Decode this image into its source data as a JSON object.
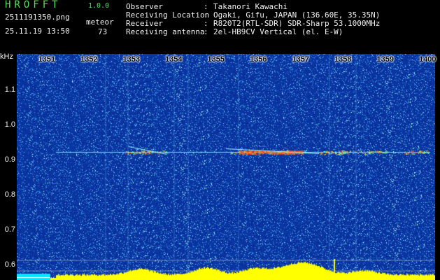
{
  "app": {
    "title": "HROFFT",
    "version": "1.0.0"
  },
  "file": {
    "name": "2511191350.png",
    "timestamp": "25.11.19 13:50"
  },
  "meteor": {
    "label": "meteor",
    "count": "73"
  },
  "info": [
    {
      "key": "Observer",
      "value": "Takanori Kawachi"
    },
    {
      "key": "Receiving Location",
      "value": "Ogaki, Gifu, JAPAN (136.60E, 35.35N)"
    },
    {
      "key": "Receiver",
      "value": "R820T2(RTL-SDR) SDR-Sharp 53.1000MHz"
    },
    {
      "key": "Receiving antenna",
      "value": "2el-HB9CV Vertical (el. E-W)"
    }
  ],
  "colon": ":",
  "chart_data": {
    "type": "heatmap",
    "ylabel": "kHz",
    "ylim": [
      0.57,
      1.2
    ],
    "y_ticks": [
      "1.1",
      "1.0",
      "0.9",
      "0.8",
      "0.7",
      "0.6"
    ],
    "x_ticks": [
      "1351",
      "1352",
      "1353",
      "1354",
      "1355",
      "1356",
      "1357",
      "1358",
      "1359",
      "1400"
    ],
    "colors": {
      "background": "#0a2a9a",
      "noise": "#5ac8ff",
      "signal_hot": "#ff3020",
      "signal_warm": "#ffe000",
      "level_bar": "#ffff00",
      "base_bar": "#00e8ff",
      "grid": "#d8d8d8"
    },
    "carrier_khz": 0.923,
    "meteor_echo_minutes": [
      1352.9,
      1353.3,
      1355.4,
      1355.8,
      1356.2,
      1356.6,
      1357.5,
      1357.9,
      1358.5,
      1359.5
    ]
  }
}
